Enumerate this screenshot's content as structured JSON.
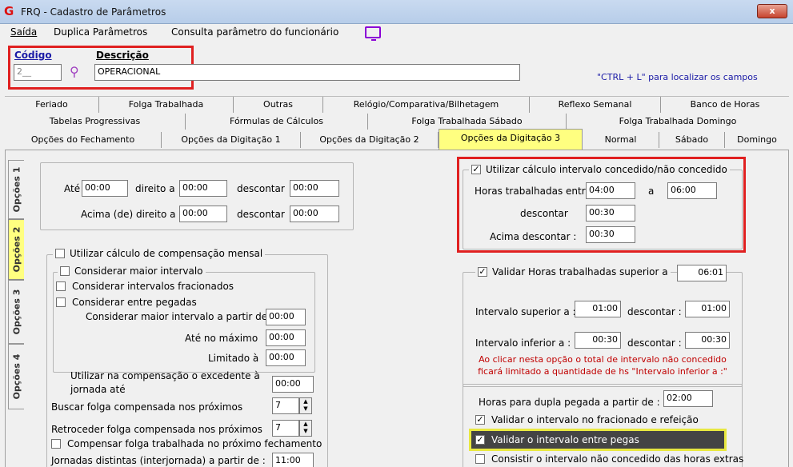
{
  "window": {
    "title": "FRQ - Cadastro de Parâmetros",
    "close": "x"
  },
  "menu": [
    "Saída",
    "Duplica Parâmetros",
    "Consulta parâmetro do funcionário"
  ],
  "header": {
    "codigo_label": "Código",
    "codigo_value": "2__",
    "descricao_label": "Descrição",
    "descricao_value": "OPERACIONAL",
    "hint": "\"CTRL + L\" para localizar os campos"
  },
  "tabs": {
    "row1": [
      "Feriado",
      "Folga Trabalhada",
      "Outras",
      "Relógio/Comparativa/Bilhetagem",
      "Reflexo Semanal",
      "Banco de Horas"
    ],
    "row2": [
      "Tabelas Progressivas",
      "Fórmulas de Cálculos",
      "Folga Trabalhada Sábado",
      "Folga Trabalhada Domingo"
    ],
    "row3": [
      "Opções do Fechamento",
      "Opções da Digitação 1",
      "Opções da Digitação 2",
      "Opções da Digitação 3",
      "Normal",
      "Sábado",
      "Domingo"
    ]
  },
  "side_tabs": [
    "Opções 1",
    "Opções 2",
    "Opções 3",
    "Opções 4"
  ],
  "left": {
    "ate_label": "Até",
    "ate_value": "00:00",
    "direito_label": "direito a",
    "direito_value": "00:00",
    "descontar_label": "descontar",
    "descontar_value": "00:00",
    "acima_label": "Acima (de) direito a",
    "acima_value": "00:00",
    "acima_desc_label": "descontar",
    "acima_desc_value": "00:00",
    "compensacao_label": "Utilizar cálculo de compensação mensal",
    "maior_intervalo_label": "Considerar maior intervalo",
    "fracionados_label": "Considerar intervalos fracionados",
    "entre_pegadas_label": "Considerar entre pegadas",
    "maior_partir_label": "Considerar maior intervalo a partir de",
    "maior_partir_value": "00:00",
    "ate_maximo_label": "Até no máximo",
    "ate_maximo_value": "00:00",
    "limitado_label": "Limitado à",
    "limitado_value": "00:00",
    "excedente_label_1": "Utilizar na compensação o excedente à",
    "excedente_label_2": "jornada até",
    "excedente_value": "00:00",
    "buscar_label": "Buscar folga compensada nos próximos",
    "buscar_value": "7",
    "retroceder_label": "Retroceder folga compensada nos próximos",
    "retroceder_value": "7",
    "compensar_label": "Compensar folga trabalhada no próximo fechamento",
    "jornadas_label": "Jornadas distintas (interjornada) a partir de :",
    "jornadas_value": "11:00"
  },
  "right": {
    "concedido_label": "Utilizar cálculo intervalo concedido/não concedido",
    "horas_entre_label": "Horas trabalhadas entre :",
    "horas_entre_from": "04:00",
    "a_label": "a",
    "horas_entre_to": "06:00",
    "descontar_label": "descontar",
    "descontar_value": "00:30",
    "acima_label": "Acima descontar :",
    "acima_value": "00:30",
    "validar_superior_label": "Validar Horas trabalhadas superior a",
    "validar_superior_value": "06:01",
    "int_sup_label": "Intervalo superior a :",
    "int_sup_value": "01:00",
    "int_sup_desc_label": "descontar :",
    "int_sup_desc_value": "01:00",
    "int_inf_label": "Intervalo inferior a :",
    "int_inf_value": "00:30",
    "int_inf_desc_label": "descontar :",
    "int_inf_desc_value": "00:30",
    "warning_1": "Ao clicar nesta opção o total de intervalo não concedido",
    "warning_2": "ficará limitado a quantidade de hs \"Intervalo inferior a :\"",
    "dupla_label": "Horas para dupla pegada a partir de :",
    "dupla_value": "02:00",
    "validar_fracionado_label": "Validar o intervalo no fracionado e refeição",
    "validar_pegas_label": "Validar o intervalo entre pegas",
    "consistir_label": "Consistir o intervalo não concedido das horas extras"
  },
  "colors": {
    "active_tab": "#ffff80",
    "highlight_box": "#e02020",
    "warning": "#c00000"
  }
}
